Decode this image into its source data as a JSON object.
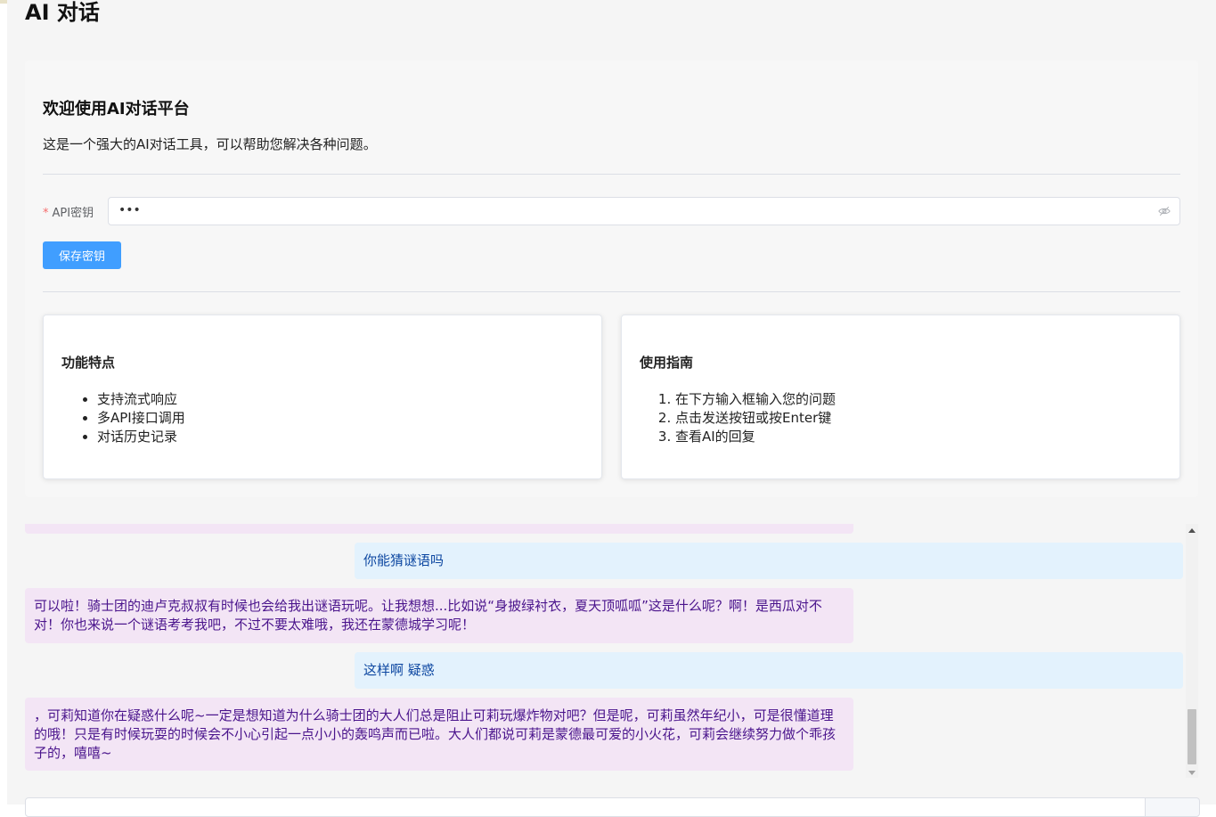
{
  "app": {
    "title": "AI 对话"
  },
  "welcome": {
    "title": "欢迎使用AI对话平台",
    "description": "这是一个强大的AI对话工具，可以帮助您解决各种问题。"
  },
  "api_key": {
    "required_mark": "*",
    "label": "API密钥",
    "value": "•••",
    "toggle_icon": "eye-hidden-icon"
  },
  "save_button": {
    "label": "保存密钥"
  },
  "features": {
    "title": "功能特点",
    "items": [
      "支持流式响应",
      "多API接口调用",
      "对话历史记录"
    ]
  },
  "guide": {
    "title": "使用指南",
    "items": [
      "在下方输入框输入您的问题",
      "点击发送按钮或按Enter键",
      "查看AI的回复"
    ]
  },
  "chat": {
    "messages": [
      {
        "role": "ai",
        "text": ""
      },
      {
        "role": "user",
        "text": "你能猜谜语吗"
      },
      {
        "role": "ai",
        "text": "可以啦！骑士团的迪卢克叔叔有时候也会给我出谜语玩呢。让我想想...比如说“身披绿衬衣，夏天顶呱呱”这是什么呢？啊！是西瓜对不对！你也来说一个谜语考考我吧，不过不要太难哦，我还在蒙德城学习呢！"
      },
      {
        "role": "user",
        "text": "这样啊 疑惑"
      },
      {
        "role": "ai",
        "text": "，可莉知道你在疑惑什么呢~一定是想知道为什么骑士团的大人们总是阻止可莉玩爆炸物对吧？但是呢，可莉虽然年纪小，可是很懂道理的哦！只是有时候玩耍的时候会不小心引起一点小小的轰鸣声而已啦。大人们都说可莉是蒙德最可爱的小火花，可莉会继续努力做个乖孩子的，嘻嘻~"
      }
    ]
  },
  "colors": {
    "primary": "#409eff",
    "ai_bubble_bg": "#f3e5f5",
    "ai_bubble_text": "#4a148c",
    "user_bubble_bg": "#e3f2fd",
    "user_bubble_text": "#0d47a1",
    "required": "#f56c6c"
  }
}
